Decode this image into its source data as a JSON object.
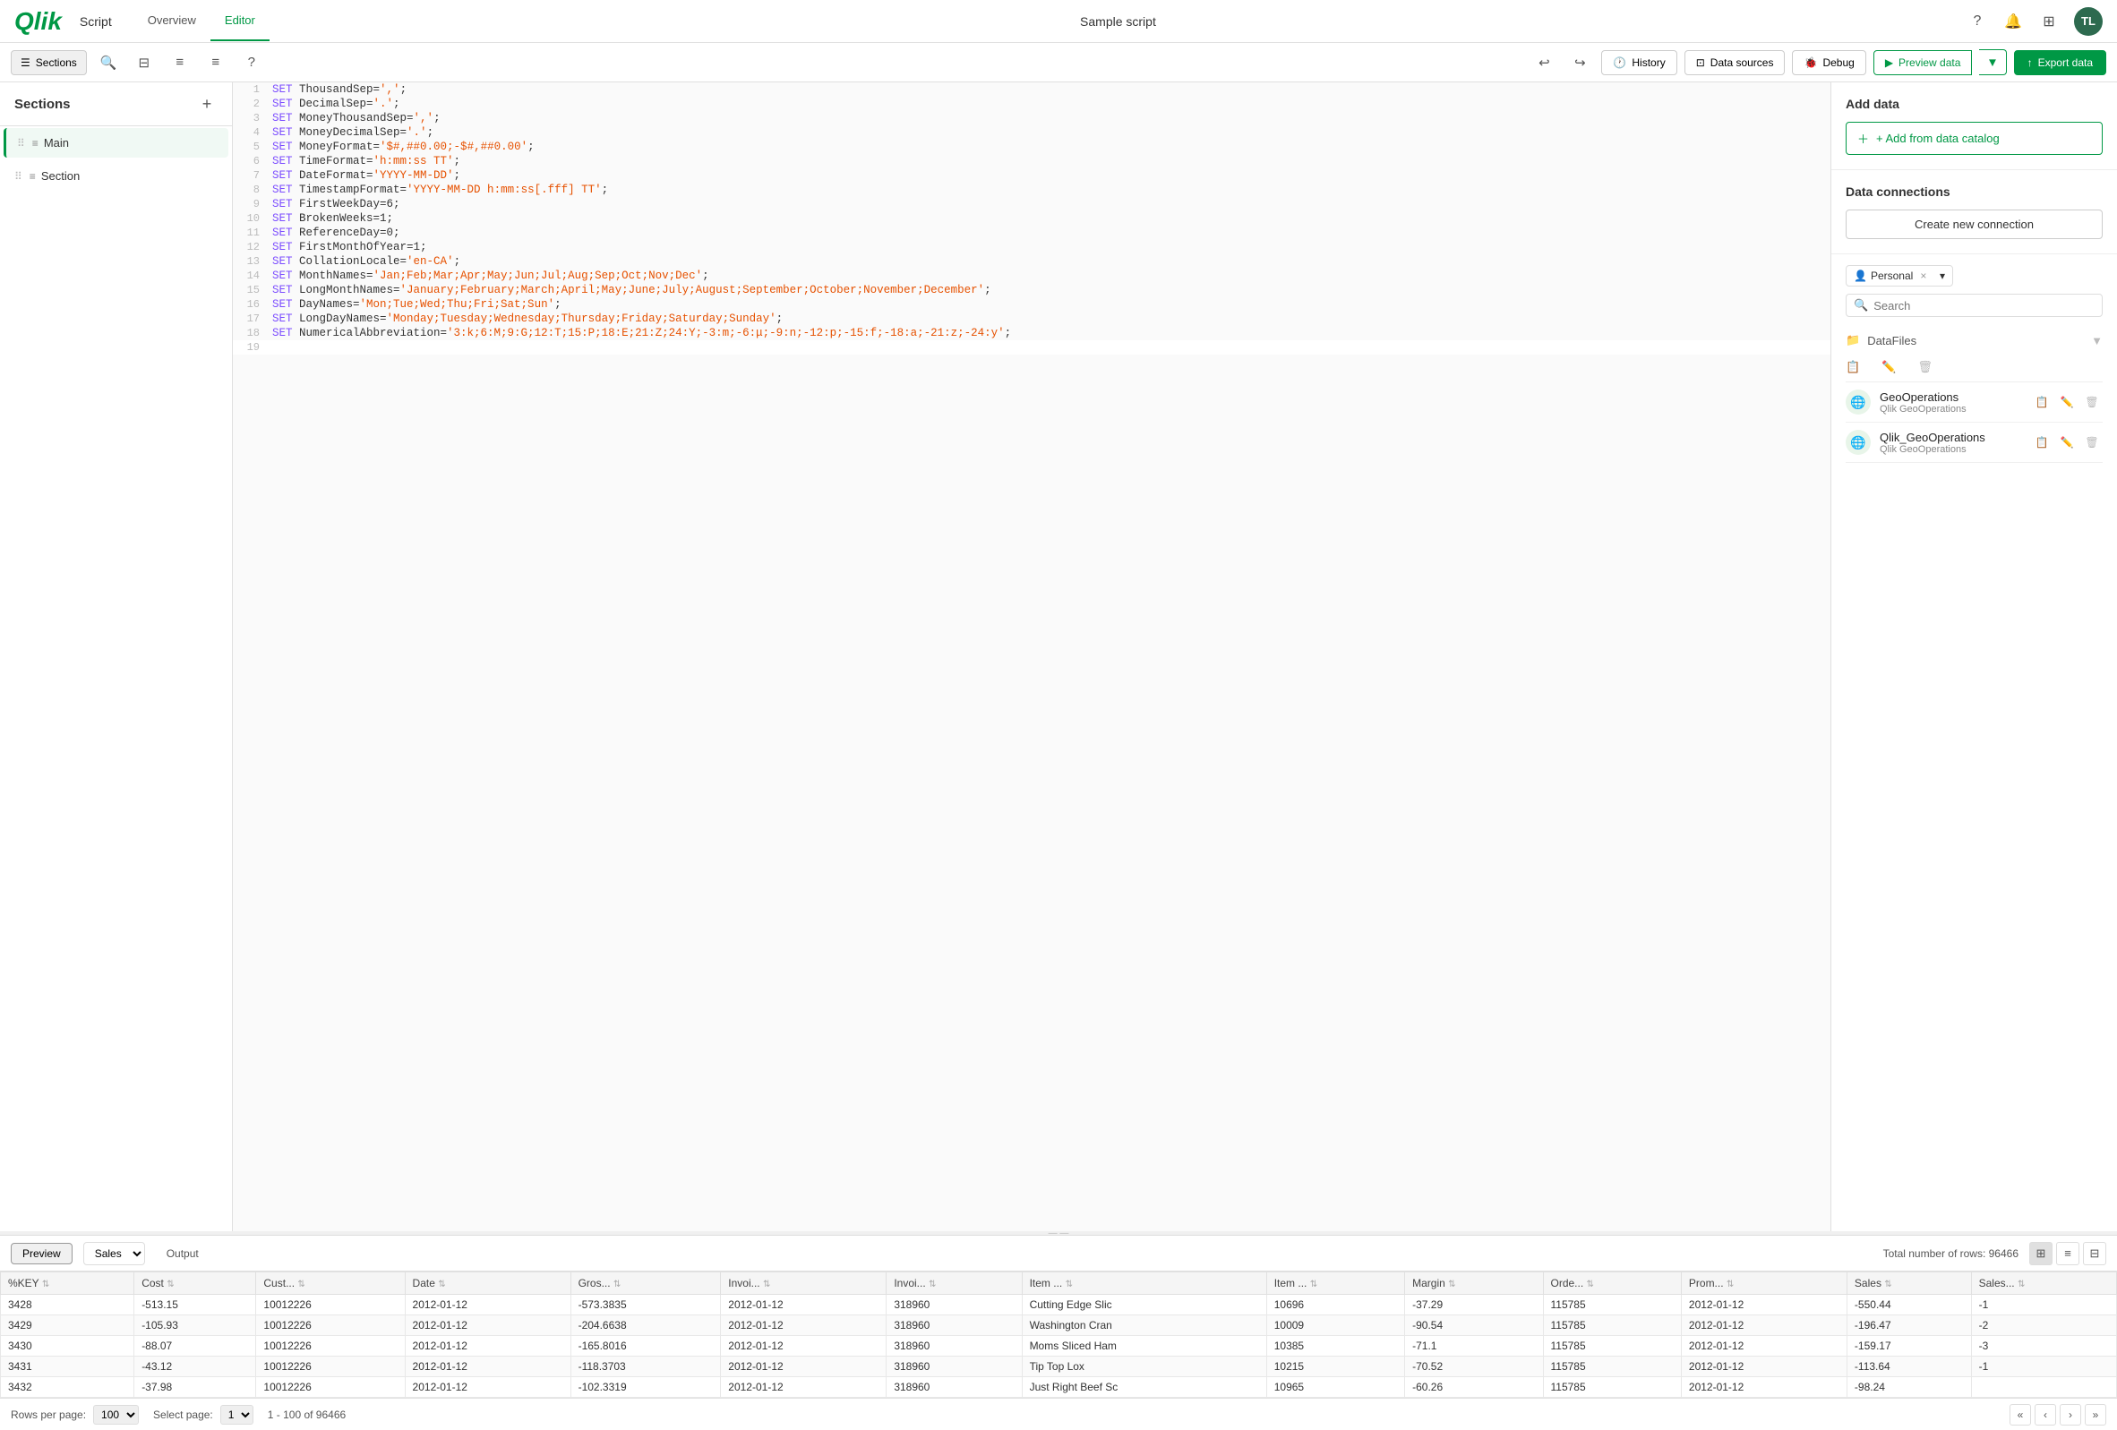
{
  "app": {
    "logo": "Qlik",
    "name": "Script",
    "nav_tabs": [
      {
        "label": "Overview",
        "active": false
      },
      {
        "label": "Editor",
        "active": true
      }
    ],
    "title": "Sample script"
  },
  "nav_right": {
    "help_icon": "?",
    "bell_icon": "🔔",
    "grid_icon": "⊞",
    "avatar": "TL"
  },
  "toolbar": {
    "sections_btn": "Sections",
    "history_btn": "History",
    "data_sources_btn": "Data sources",
    "debug_btn": "Debug",
    "preview_btn": "Preview data",
    "export_btn": "Export data"
  },
  "sidebar": {
    "title": "Sections",
    "add_icon": "+",
    "items": [
      {
        "label": "Main",
        "active": true
      },
      {
        "label": "Section",
        "active": false
      }
    ]
  },
  "editor": {
    "lines": [
      {
        "num": 1,
        "content": "SET ThousandSep=',';",
        "tokens": [
          {
            "type": "kw",
            "text": "SET"
          },
          {
            "type": "normal",
            "text": " ThousandSep="
          },
          {
            "type": "str",
            "text": "','"
          },
          {
            "type": "normal",
            "text": ";"
          }
        ]
      },
      {
        "num": 2,
        "content": "SET DecimalSep='.';",
        "tokens": [
          {
            "type": "kw",
            "text": "SET"
          },
          {
            "type": "normal",
            "text": " DecimalSep="
          },
          {
            "type": "str",
            "text": "'.'"
          },
          {
            "type": "normal",
            "text": ";"
          }
        ]
      },
      {
        "num": 3,
        "content": "SET MoneyThousandSep=',';",
        "tokens": [
          {
            "type": "kw",
            "text": "SET"
          },
          {
            "type": "normal",
            "text": " MoneyThousandSep="
          },
          {
            "type": "str",
            "text": "','"
          },
          {
            "type": "normal",
            "text": ";"
          }
        ]
      },
      {
        "num": 4,
        "content": "SET MoneyDecimalSep='.';",
        "tokens": [
          {
            "type": "kw",
            "text": "SET"
          },
          {
            "type": "normal",
            "text": " MoneyDecimalSep="
          },
          {
            "type": "str",
            "text": "'.'"
          },
          {
            "type": "normal",
            "text": ";"
          }
        ]
      },
      {
        "num": 5,
        "content": "SET MoneyFormat='$#,##0.00;-$#,##0.00';",
        "tokens": [
          {
            "type": "kw",
            "text": "SET"
          },
          {
            "type": "normal",
            "text": " MoneyFormat="
          },
          {
            "type": "str",
            "text": "'$#,##0.00;-$#,##0.00'"
          },
          {
            "type": "normal",
            "text": ";"
          }
        ]
      },
      {
        "num": 6,
        "content": "SET TimeFormat='h:mm:ss TT';",
        "tokens": [
          {
            "type": "kw",
            "text": "SET"
          },
          {
            "type": "normal",
            "text": " TimeFormat="
          },
          {
            "type": "str",
            "text": "'h:mm:ss TT'"
          },
          {
            "type": "normal",
            "text": ";"
          }
        ]
      },
      {
        "num": 7,
        "content": "SET DateFormat='YYYY-MM-DD';",
        "tokens": [
          {
            "type": "kw",
            "text": "SET"
          },
          {
            "type": "normal",
            "text": " DateFormat="
          },
          {
            "type": "str",
            "text": "'YYYY-MM-DD'"
          },
          {
            "type": "normal",
            "text": ";"
          }
        ]
      },
      {
        "num": 8,
        "content": "SET TimestampFormat='YYYY-MM-DD h:mm:ss[.fff] TT';",
        "tokens": [
          {
            "type": "kw",
            "text": "SET"
          },
          {
            "type": "normal",
            "text": " TimestampFormat="
          },
          {
            "type": "str",
            "text": "'YYYY-MM-DD h:mm:ss[.fff] TT'"
          },
          {
            "type": "normal",
            "text": ";"
          }
        ]
      },
      {
        "num": 9,
        "content": "SET FirstWeekDay=6;",
        "tokens": [
          {
            "type": "kw",
            "text": "SET"
          },
          {
            "type": "normal",
            "text": " FirstWeekDay=6;"
          }
        ]
      },
      {
        "num": 10,
        "content": "SET BrokenWeeks=1;",
        "tokens": [
          {
            "type": "kw",
            "text": "SET"
          },
          {
            "type": "normal",
            "text": " BrokenWeeks=1;"
          }
        ]
      },
      {
        "num": 11,
        "content": "SET ReferenceDay=0;",
        "tokens": [
          {
            "type": "kw",
            "text": "SET"
          },
          {
            "type": "normal",
            "text": " ReferenceDay=0;"
          }
        ]
      },
      {
        "num": 12,
        "content": "SET FirstMonthOfYear=1;",
        "tokens": [
          {
            "type": "kw",
            "text": "SET"
          },
          {
            "type": "normal",
            "text": " FirstMonthOfYear=1;"
          }
        ]
      },
      {
        "num": 13,
        "content": "SET CollationLocale='en-CA';",
        "tokens": [
          {
            "type": "kw",
            "text": "SET"
          },
          {
            "type": "normal",
            "text": " CollationLocale="
          },
          {
            "type": "str",
            "text": "'en-CA'"
          },
          {
            "type": "normal",
            "text": ";"
          }
        ]
      },
      {
        "num": 14,
        "content": "SET MonthNames='Jan;Feb;Mar;Apr;May;Jun;Jul;Aug;Sep;Oct;Nov;Dec';",
        "tokens": [
          {
            "type": "kw",
            "text": "SET"
          },
          {
            "type": "normal",
            "text": " MonthNames="
          },
          {
            "type": "str",
            "text": "'Jan;Feb;Mar;Apr;May;Jun;Jul;Aug;Sep;Oct;Nov;Dec'"
          },
          {
            "type": "normal",
            "text": ";"
          }
        ]
      },
      {
        "num": 15,
        "content": "SET LongMonthNames='January;February;March;April;May;June;July;August;September;October;November;December';",
        "tokens": [
          {
            "type": "kw",
            "text": "SET"
          },
          {
            "type": "normal",
            "text": " LongMonthNames="
          },
          {
            "type": "str",
            "text": "'January;February;March;April;May;June;July;August;September;October;November;December'"
          },
          {
            "type": "normal",
            "text": ";"
          }
        ]
      },
      {
        "num": 16,
        "content": "SET DayNames='Mon;Tue;Wed;Thu;Fri;Sat;Sun';",
        "tokens": [
          {
            "type": "kw",
            "text": "SET"
          },
          {
            "type": "normal",
            "text": " DayNames="
          },
          {
            "type": "str",
            "text": "'Mon;Tue;Wed;Thu;Fri;Sat;Sun'"
          },
          {
            "type": "normal",
            "text": ";"
          }
        ]
      },
      {
        "num": 17,
        "content": "SET LongDayNames='Monday;Tuesday;Wednesday;Thursday;Friday;Saturday;Sunday';",
        "tokens": [
          {
            "type": "kw",
            "text": "SET"
          },
          {
            "type": "normal",
            "text": " LongDayNames="
          },
          {
            "type": "str",
            "text": "'Monday;Tuesday;Wednesday;Thursday;Friday;Saturday;Sunday'"
          },
          {
            "type": "normal",
            "text": ";"
          }
        ]
      },
      {
        "num": 18,
        "content": "SET NumericalAbbreviation='3:k;6:M;9:G;12:T;15:P;18:E;21:Z;24:Y;-3:m;-6:μ;-9:n;-12:p;-15:f;-18:a;-21:z;-24:y';",
        "tokens": [
          {
            "type": "kw",
            "text": "SET"
          },
          {
            "type": "normal",
            "text": " NumericalAbbreviation="
          },
          {
            "type": "str",
            "text": "'3:k;6:M;9:G;12:T;15:P;18:E;21:Z;24:Y;-3:m;-6:μ;-9:n;-12:p;-15:f;-18:a;-21:z;-24:y'"
          },
          {
            "type": "normal",
            "text": ";"
          }
        ]
      },
      {
        "num": 19,
        "content": "",
        "tokens": []
      }
    ]
  },
  "right_panel": {
    "add_data_title": "Add data",
    "add_catalog_btn": "+ Add from data catalog",
    "data_connections_title": "Data connections",
    "create_connection_btn": "Create new connection",
    "search_placeholder": "Search",
    "filter_label": "Personal",
    "folder_label": "DataFiles",
    "folder_icon": "📁",
    "connections": [
      {
        "name": "GeoOperations",
        "type": "Qlik GeoOperations"
      },
      {
        "name": "Qlik_GeoOperations",
        "type": "Qlik GeoOperations"
      }
    ]
  },
  "preview": {
    "btn_label": "Preview",
    "table_label": "Sales",
    "output_label": "Output",
    "row_count": "Total number of rows: 96466",
    "columns": [
      "%KEY",
      "Cost",
      "Cust...",
      "Date",
      "Gros...",
      "Invoi...",
      "Invoi...",
      "Item ...",
      "Item ...",
      "Margin",
      "Orde...",
      "Prom...",
      "Sales",
      "Sales..."
    ],
    "rows": [
      [
        "3428",
        "-513.15",
        "10012226",
        "2012-01-12",
        "-573.3835",
        "2012-01-12",
        "318960",
        "Cutting Edge Slic",
        "10696",
        "-37.29",
        "115785",
        "2012-01-12",
        "-550.44",
        "-1"
      ],
      [
        "3429",
        "-105.93",
        "10012226",
        "2012-01-12",
        "-204.6638",
        "2012-01-12",
        "318960",
        "Washington Cran",
        "10009",
        "-90.54",
        "115785",
        "2012-01-12",
        "-196.47",
        "-2"
      ],
      [
        "3430",
        "-88.07",
        "10012226",
        "2012-01-12",
        "-165.8016",
        "2012-01-12",
        "318960",
        "Moms Sliced Ham",
        "10385",
        "-71.1",
        "115785",
        "2012-01-12",
        "-159.17",
        "-3"
      ],
      [
        "3431",
        "-43.12",
        "10012226",
        "2012-01-12",
        "-118.3703",
        "2012-01-12",
        "318960",
        "Tip Top Lox",
        "10215",
        "-70.52",
        "115785",
        "2012-01-12",
        "-113.64",
        "-1"
      ],
      [
        "3432",
        "-37.98",
        "10012226",
        "2012-01-12",
        "-102.3319",
        "2012-01-12",
        "318960",
        "Just Right Beef Sc",
        "10965",
        "-60.26",
        "115785",
        "2012-01-12",
        "-98.24",
        ""
      ]
    ],
    "footer": {
      "rows_label": "Rows per page:",
      "rows_value": "100",
      "page_label": "Select page:",
      "page_value": "1",
      "page_info": "1 - 100 of 96466"
    }
  }
}
